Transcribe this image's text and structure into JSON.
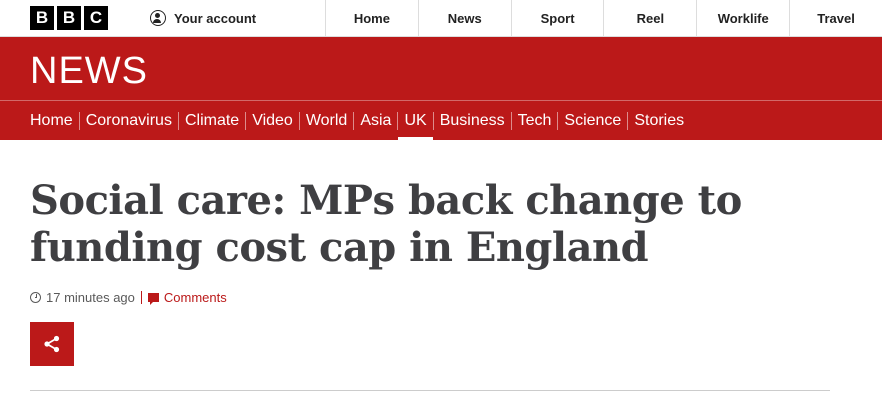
{
  "topbar": {
    "logo_letters": [
      "B",
      "B",
      "C"
    ],
    "account_label": "Your account",
    "links": [
      "Home",
      "News",
      "Sport",
      "Reel",
      "Worklife",
      "Travel"
    ]
  },
  "masthead": {
    "title": "NEWS"
  },
  "subnav": {
    "items": [
      "Home",
      "Coronavirus",
      "Climate",
      "Video",
      "World",
      "Asia",
      "UK",
      "Business",
      "Tech",
      "Science",
      "Stories"
    ],
    "active": "UK"
  },
  "article": {
    "headline": "Social care: MPs back change to funding cost cap in England",
    "timestamp": "17 minutes ago",
    "comments_label": "Comments"
  },
  "colors": {
    "brand_red": "#bb1919",
    "headline": "#3f3f42"
  },
  "icons": {
    "account": "user-circle-icon",
    "time": "clock-icon",
    "comments": "comment-icon",
    "share": "share-icon"
  }
}
